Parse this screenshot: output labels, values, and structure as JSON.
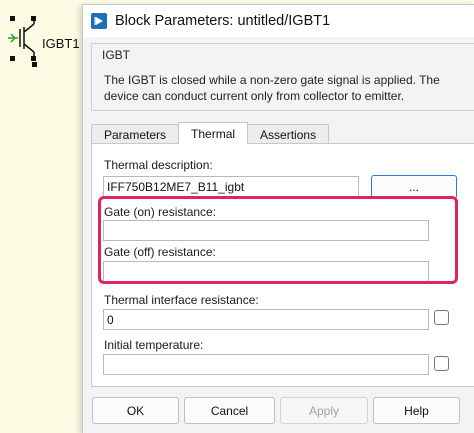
{
  "canvas": {
    "block_label": "IGBT1"
  },
  "dialog": {
    "title": "Block Parameters: untitled/IGBT1",
    "group_title": "IGBT",
    "description": "The IGBT is closed while a non-zero gate signal is applied. The device can conduct current only from collector to emitter."
  },
  "tabs": [
    {
      "label": "Parameters",
      "active": false
    },
    {
      "label": "Thermal",
      "active": true
    },
    {
      "label": "Assertions",
      "active": false
    }
  ],
  "thermal": {
    "description_label": "Thermal description:",
    "description_value": "IFF750B12ME7_B11_igbt",
    "browse_label": "...",
    "gate_on_label": "Gate (on) resistance:",
    "gate_on_value": "",
    "gate_off_label": "Gate (off) resistance:",
    "gate_off_value": "",
    "interface_label": "Thermal interface resistance:",
    "interface_value": "0",
    "initial_temp_label": "Initial temperature:",
    "initial_temp_value": ""
  },
  "buttons": {
    "ok": "OK",
    "cancel": "Cancel",
    "apply": "Apply",
    "help": "Help"
  },
  "colors": {
    "highlight": "#e0245e",
    "accent": "#2c7bd6",
    "canvas": "#fdfbe4"
  },
  "icons": {
    "title": "simulink-block-icon",
    "block": "igbt-symbol-icon"
  }
}
